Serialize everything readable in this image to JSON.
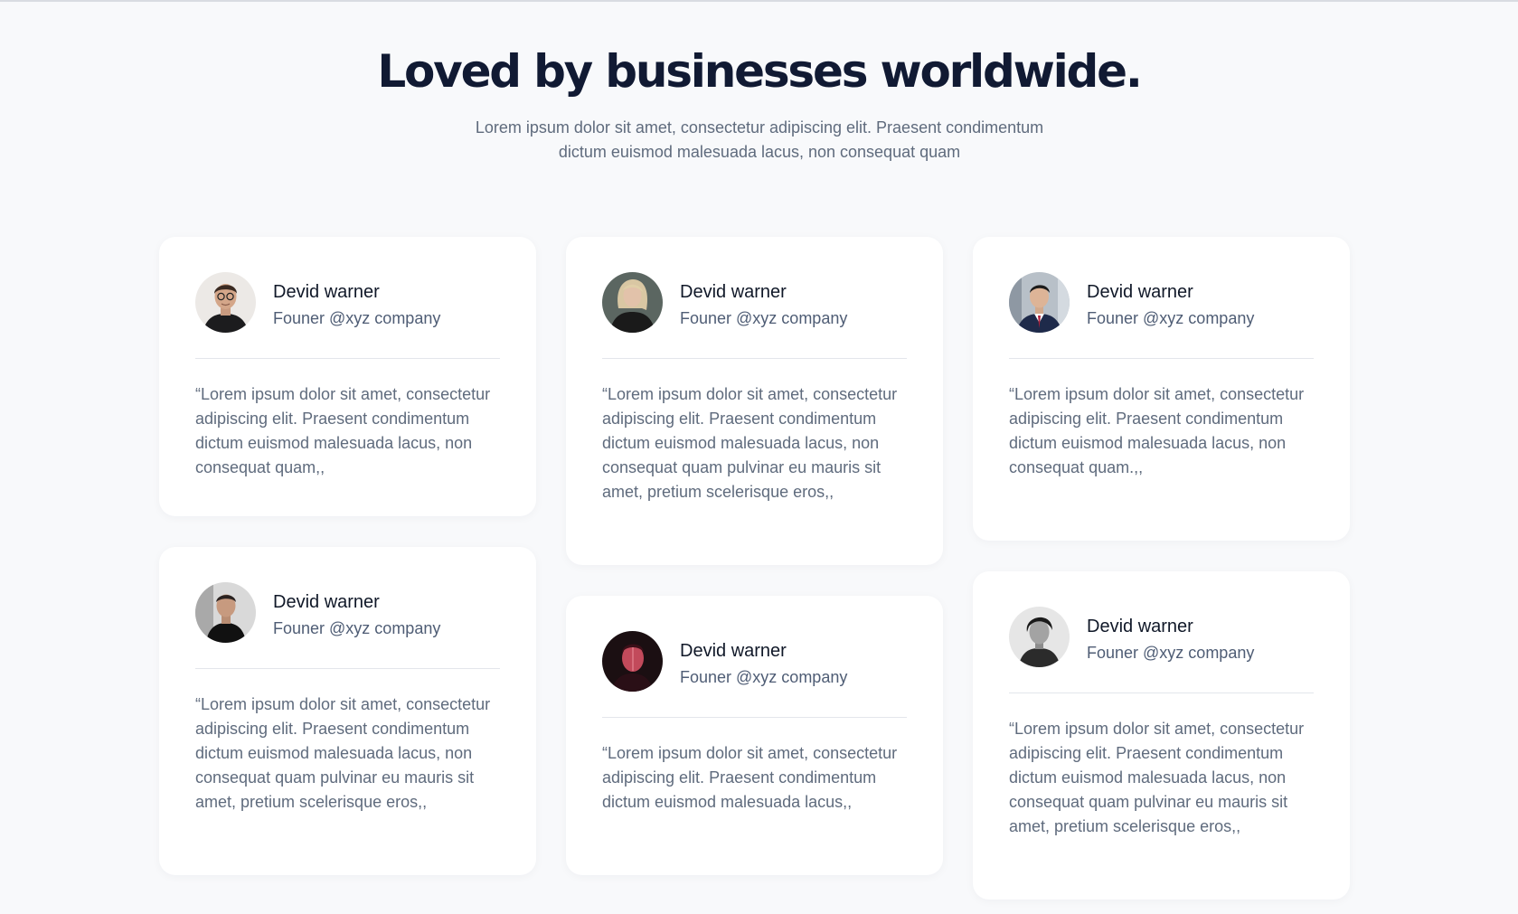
{
  "section": {
    "title": "Loved by businesses worldwide.",
    "subtitle_line1": "Lorem ipsum dolor sit amet, consectetur adipiscing elit. Praesent condimentum",
    "subtitle_line2": "dictum euismod malesuada lacus, non consequat quam"
  },
  "testimonials": [
    {
      "name": "Devid warner",
      "role": "Founer @xyz company",
      "quote": "“Lorem ipsum dolor sit amet, consectetur adipiscing elit. Praesent condimentum dictum euismod malesuada lacus, non consequat quam,,",
      "avatar_icon": "avatar-man-glasses-icon"
    },
    {
      "name": "Devid warner",
      "role": "Founer @xyz company",
      "quote": "“Lorem ipsum dolor sit amet, consectetur adipiscing elit. Praesent condimentum dictum euismod malesuada lacus, non consequat quam pulvinar eu mauris sit amet, pretium scelerisque eros,,",
      "avatar_icon": "avatar-woman-blonde-icon"
    },
    {
      "name": "Devid warner",
      "role": "Founer @xyz company",
      "quote": "“Lorem ipsum dolor sit amet, consectetur adipiscing elit. Praesent condimentum dictum euismod malesuada lacus, non consequat quam.,,",
      "avatar_icon": "avatar-man-suit-icon"
    },
    {
      "name": "Devid warner",
      "role": "Founer @xyz company",
      "quote": "“Lorem ipsum dolor sit amet, consectetur adipiscing elit. Praesent condimentum dictum euismod malesuada lacus, non consequat quam pulvinar eu mauris sit amet, pretium scelerisque eros,,",
      "avatar_icon": "avatar-man-black-shirt-icon"
    },
    {
      "name": "Devid warner",
      "role": "Founer @xyz company",
      "quote": "“Lorem ipsum dolor sit amet, consectetur adipiscing elit. Praesent condimentum dictum euismod malesuada lacus,,",
      "avatar_icon": "avatar-man-red-light-icon"
    },
    {
      "name": "Devid warner",
      "role": "Founer @xyz company",
      "quote": "“Lorem ipsum dolor sit amet, consectetur adipiscing elit. Praesent condimentum dictum euismod malesuada lacus, non consequat quam pulvinar eu mauris sit amet, pretium scelerisque eros,,",
      "avatar_icon": "avatar-man-bw-portrait-icon"
    }
  ],
  "colors": {
    "background": "#f8f9fb",
    "heading": "#111a33",
    "body_text": "#5f6b7d",
    "card": "#ffffff"
  }
}
